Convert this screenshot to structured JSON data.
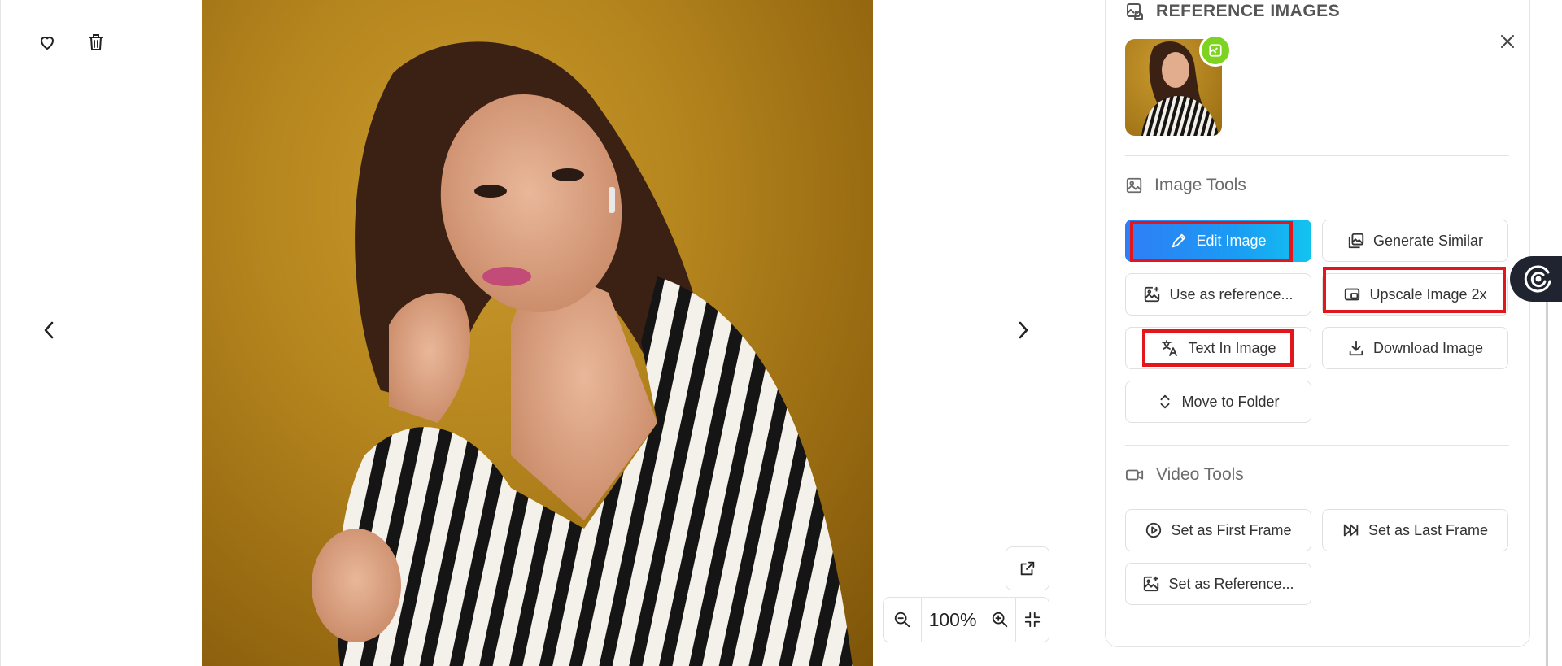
{
  "viewer": {
    "zoom_level": "100%"
  },
  "panel": {
    "reference_title": "REFERENCE IMAGES",
    "image_tools_title": "Image Tools",
    "image_tools": [
      {
        "label": "Edit Image",
        "icon": "pencil-icon",
        "style": "primary"
      },
      {
        "label": "Generate Similar",
        "icon": "images-icon"
      },
      {
        "label": "Use as reference...",
        "icon": "image-plus-icon"
      },
      {
        "label": "Upscale Image 2x",
        "icon": "upscale-icon"
      },
      {
        "label": "Text In Image",
        "icon": "translate-icon"
      },
      {
        "label": "Download Image",
        "icon": "download-icon"
      },
      {
        "label": "Move to Folder",
        "icon": "chevrons-up-down-icon"
      }
    ],
    "video_tools_title": "Video Tools",
    "video_tools": [
      {
        "label": "Set as First Frame",
        "icon": "play-circle-icon"
      },
      {
        "label": "Set as Last Frame",
        "icon": "skip-forward-icon"
      },
      {
        "label": "Set as Reference...",
        "icon": "image-plus-icon"
      }
    ]
  },
  "colors": {
    "primary_gradient_start": "#2f7df6",
    "primary_gradient_end": "#12c4f0",
    "highlight": "#e3171b",
    "badge": "#7ed321",
    "photo_background": "#b7871f"
  }
}
